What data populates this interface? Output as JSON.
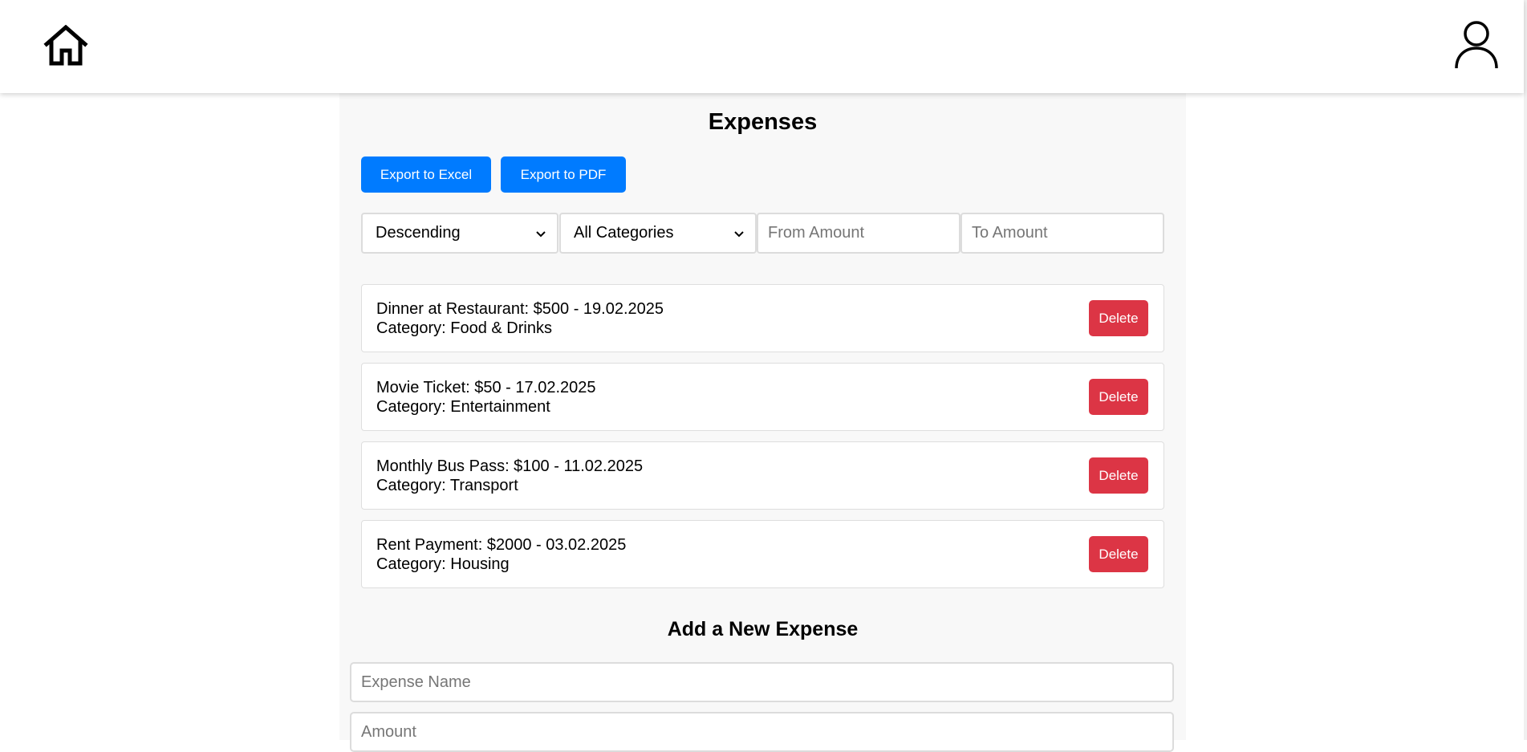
{
  "navbar": {
    "home_icon": "home-icon",
    "profile_icon": "user-icon"
  },
  "page": {
    "title": "Expenses",
    "export_excel_label": "Export to Excel",
    "export_pdf_label": "Export to PDF",
    "accent_color": "#007bff",
    "danger_color": "#dc3545"
  },
  "filters": {
    "order_selected": "Descending",
    "category_selected": "All Categories",
    "from_amount_placeholder": "From Amount",
    "to_amount_placeholder": "To Amount"
  },
  "expenses": [
    {
      "line1": "Dinner at Restaurant: $500 - 19.02.2025",
      "line2": "Category: Food & Drinks",
      "delete_label": "Delete"
    },
    {
      "line1": "Movie Ticket: $50 - 17.02.2025",
      "line2": "Category: Entertainment",
      "delete_label": "Delete"
    },
    {
      "line1": "Monthly Bus Pass: $100 - 11.02.2025",
      "line2": "Category: Transport",
      "delete_label": "Delete"
    },
    {
      "line1": "Rent Payment: $2000 - 03.02.2025",
      "line2": "Category: Housing",
      "delete_label": "Delete"
    }
  ],
  "add_form": {
    "title": "Add a New Expense",
    "name_placeholder": "Expense Name",
    "amount_placeholder": "Amount"
  }
}
